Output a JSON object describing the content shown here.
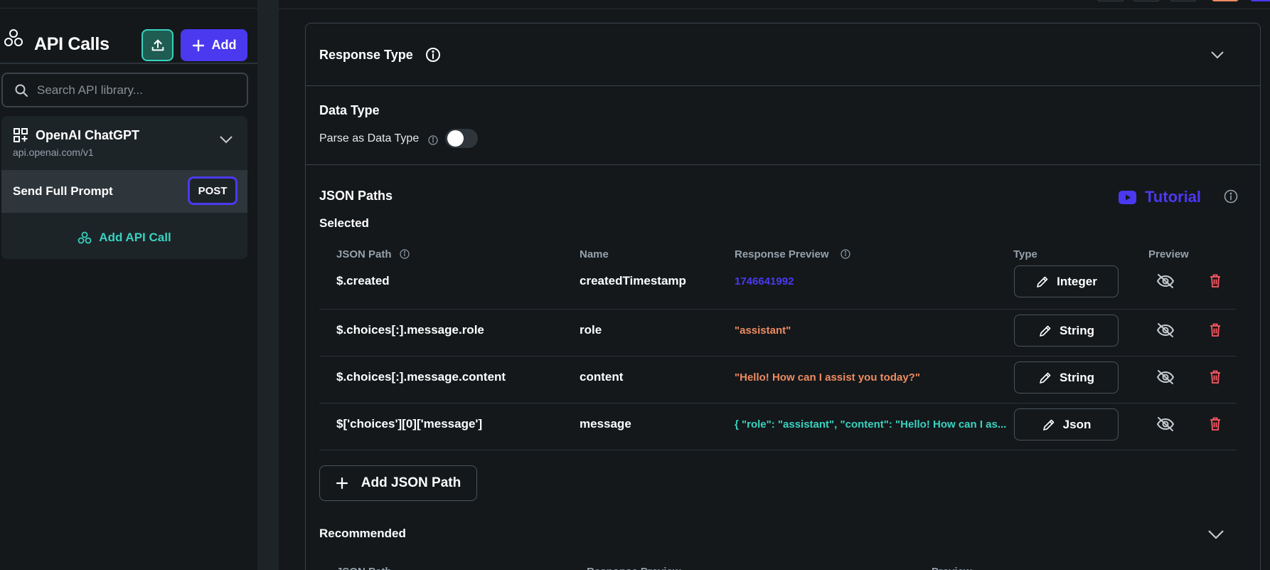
{
  "sidebar": {
    "title": "API Calls",
    "add_label": "Add",
    "search_placeholder": "Search API library...",
    "group": {
      "title": "OpenAI ChatGPT",
      "subtitle": "api.openai.com/v1"
    },
    "api_item": {
      "label": "Send Full Prompt",
      "method": "POST"
    },
    "add_api_call_label": "Add API Call"
  },
  "main": {
    "response_type_title": "Response Type",
    "data_type_title": "Data Type",
    "parse_label": "Parse as Data Type",
    "parse_enabled": false,
    "json_paths_title": "JSON Paths",
    "tutorial_label": "Tutorial",
    "selected_label": "Selected",
    "columns": {
      "path": "JSON Path",
      "name": "Name",
      "preview": "Response Preview",
      "type": "Type",
      "preview_toggle": "Preview"
    },
    "rows": [
      {
        "path": "$.created",
        "name": "createdTimestamp",
        "preview": "1746641992",
        "preview_color": "#4b39ef",
        "type": "Integer"
      },
      {
        "path": "$.choices[:].message.role",
        "name": "role",
        "preview": "\"assistant\"",
        "preview_color": "#ee8b60",
        "type": "String"
      },
      {
        "path": "$.choices[:].message.content",
        "name": "content",
        "preview": "\"Hello! How can I assist you today?\"",
        "preview_color": "#ee8b60",
        "type": "String"
      },
      {
        "path": "$['choices'][0]['message']",
        "name": "message",
        "preview": "{  \"role\": \"assistant\",  \"content\": \"Hello! How can I as...",
        "preview_color": "#39d2c0",
        "type": "Json"
      }
    ],
    "add_json_path_label": "Add JSON Path",
    "recommended_label": "Recommended"
  },
  "colors": {
    "primary": "#4b39ef",
    "secondary": "#39d2c0",
    "error": "#ff5963",
    "background": "#14181b"
  }
}
